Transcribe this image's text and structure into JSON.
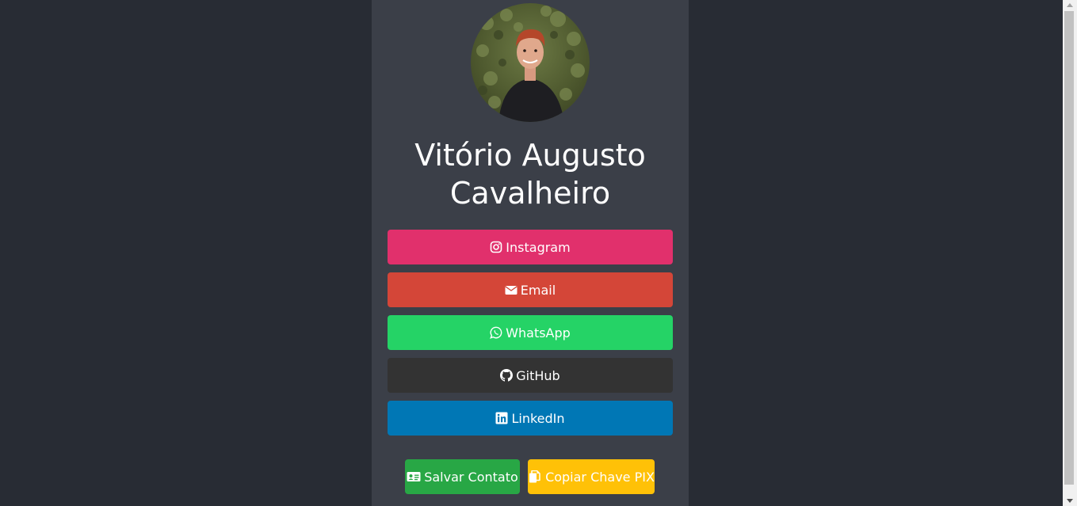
{
  "profile": {
    "name_line1": "Vitório Augusto",
    "name_line2": "Cavalheiro",
    "avatar": "profile-photo"
  },
  "links": [
    {
      "label": "Instagram",
      "icon": "instagram-icon",
      "color": "#e1306c"
    },
    {
      "label": "Email",
      "icon": "envelope-icon",
      "color": "#d44638"
    },
    {
      "label": "WhatsApp",
      "icon": "whatsapp-icon",
      "color": "#25d366"
    },
    {
      "label": "GitHub",
      "icon": "github-icon",
      "color": "#333333"
    },
    {
      "label": "LinkedIn",
      "icon": "linkedin-icon",
      "color": "#0077b5"
    }
  ],
  "actions": {
    "save_contact": {
      "label": "Salvar Contato",
      "icon": "id-card-icon",
      "color": "#28a745"
    },
    "copy_pix": {
      "label": "Copiar Chave PIX",
      "icon": "copy-icon",
      "color": "#ffc107"
    }
  },
  "colors": {
    "page_background": "#282c34",
    "card_background": "#3b3f48"
  }
}
